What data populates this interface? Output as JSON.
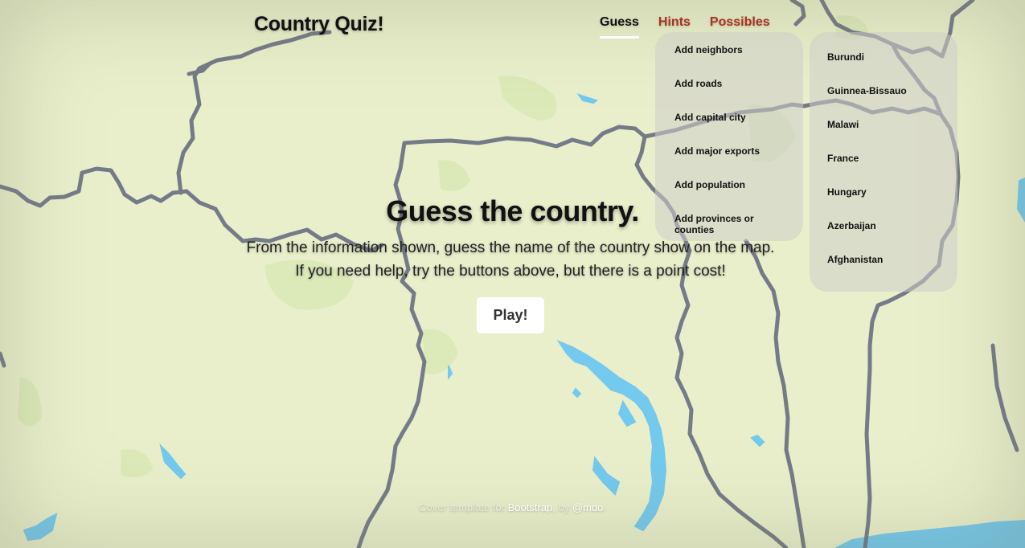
{
  "header": {
    "title": "Country Quiz!",
    "nav": [
      {
        "label": "Guess",
        "active": true
      },
      {
        "label": "Hints",
        "active": false
      },
      {
        "label": "Possibles",
        "active": false
      }
    ]
  },
  "hints": [
    "Add neighbors",
    "Add roads",
    "Add capital city",
    "Add major exports",
    "Add population",
    "Add provinces or counties"
  ],
  "possibles": [
    "Burundi",
    "Guinnea-Bissauo",
    "Malawi",
    "France",
    "Hungary",
    "Azerbaijan",
    "Afghanistan"
  ],
  "main": {
    "heading": "Guess the country.",
    "lead": "From the information shown, guess the name of the country show on the map. If you need help, try the buttons above, but there is a point cost!",
    "play_label": "Play!"
  },
  "footer": {
    "text_before": "Cover template for",
    "link1": "Bootstrap",
    "text_middle": ", by",
    "link2": "@mdo",
    "text_after": "."
  },
  "colors": {
    "map_land": "#e9efcb",
    "park_green": "#d8e8b6",
    "water": "#74c9ee",
    "border": "#6f7484",
    "accent_red": "#a83320"
  }
}
